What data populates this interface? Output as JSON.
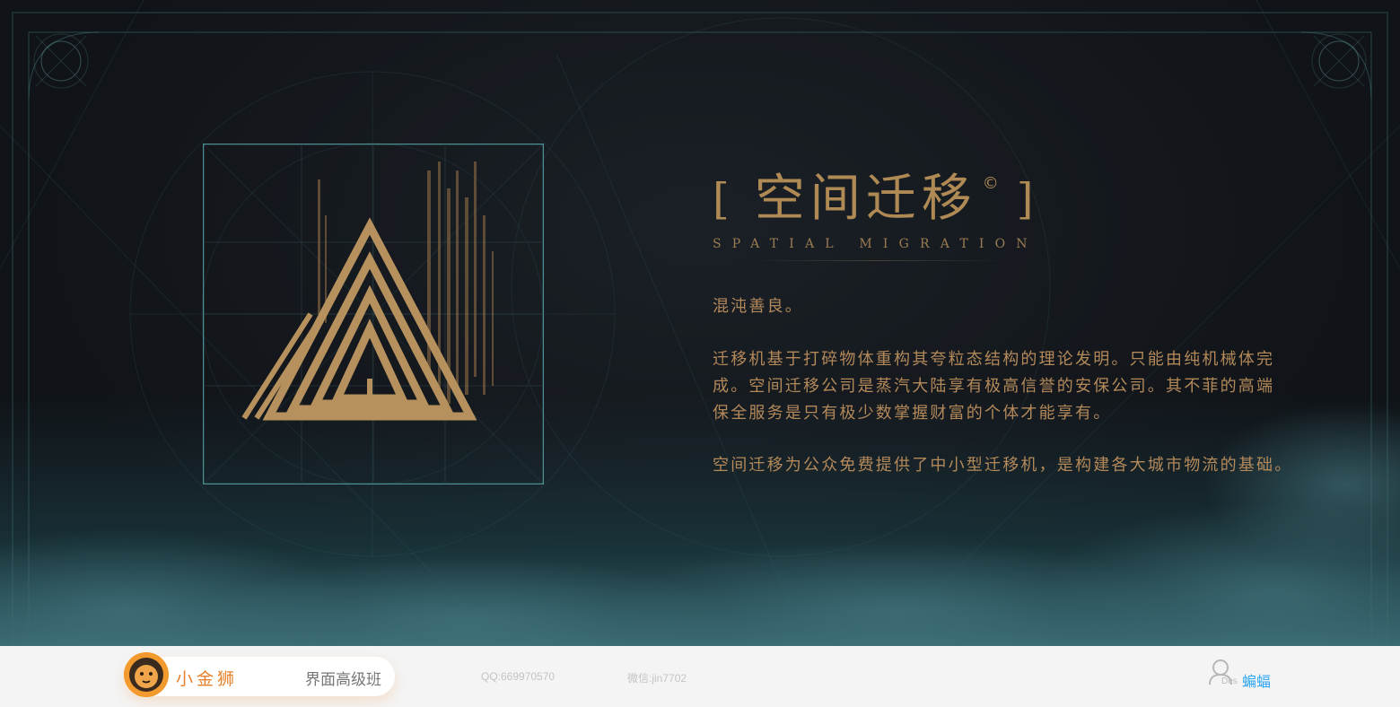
{
  "hero": {
    "title": "空间迁移",
    "title_mark": "©",
    "bracket_left": "[",
    "bracket_right": "]",
    "subtitle": "SPATIAL MIGRATION",
    "paragraphs": [
      "混沌善良。",
      "迁移机基于打碎物体重构其夸粒态结构的理论发明。只能由纯机械体完成。空间迁移公司是蒸汽大陆享有极高信誉的安保公司。其不菲的高端保全服务是只有极少数掌握财富的个体才能享有。",
      "空间迁移为公众免费提供了中小型迁移机，是构建各大城市物流的基础。"
    ]
  },
  "footer": {
    "brand_name": "小金狮",
    "course": "界面高级班",
    "qq": "QQ:669970570",
    "wechat": "微信:jin7702",
    "author_tag": "Des",
    "author_name": "蝙蝠"
  },
  "colors": {
    "gold": "#b08a55",
    "teal_border": "#4d8f92",
    "footer_orange": "#e7812c",
    "author_blue": "#2ea7f2"
  },
  "icons": {
    "logo": "triangle-logo-icon",
    "brand": "lion-avatar-icon",
    "author": "user-icon"
  }
}
